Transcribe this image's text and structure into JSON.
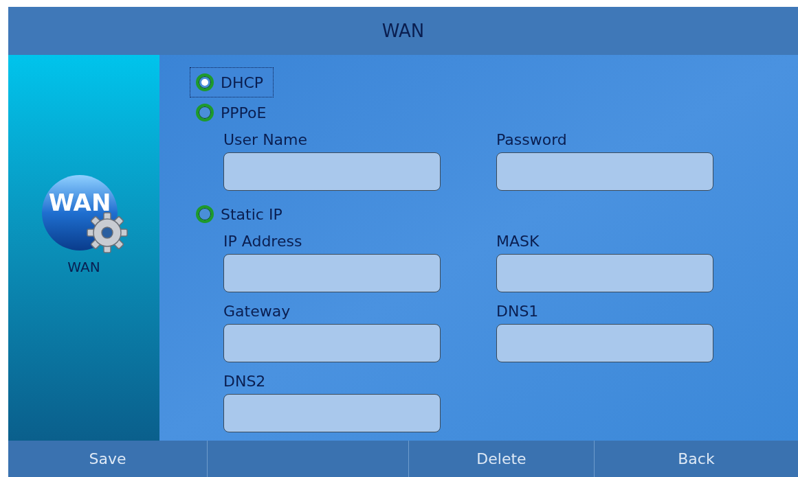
{
  "header": {
    "title": "WAN"
  },
  "sidebar": {
    "icon_text": "WAN",
    "label": "WAN"
  },
  "modes": [
    {
      "label": "DHCP",
      "selected": true,
      "focused": true
    },
    {
      "label": "PPPoE",
      "selected": false,
      "focused": false,
      "fields": [
        {
          "label": "User Name"
        },
        {
          "label": "Password"
        }
      ]
    },
    {
      "label": "Static IP",
      "selected": false,
      "focused": false,
      "fields": [
        {
          "label": "IP Address"
        },
        {
          "label": "MASK"
        },
        {
          "label": "Gateway"
        },
        {
          "label": "DNS1"
        },
        {
          "label": "DNS2"
        }
      ]
    }
  ],
  "softkeys": [
    {
      "label": "Save"
    },
    {
      "label": "Delete"
    },
    {
      "label": "Back"
    }
  ]
}
